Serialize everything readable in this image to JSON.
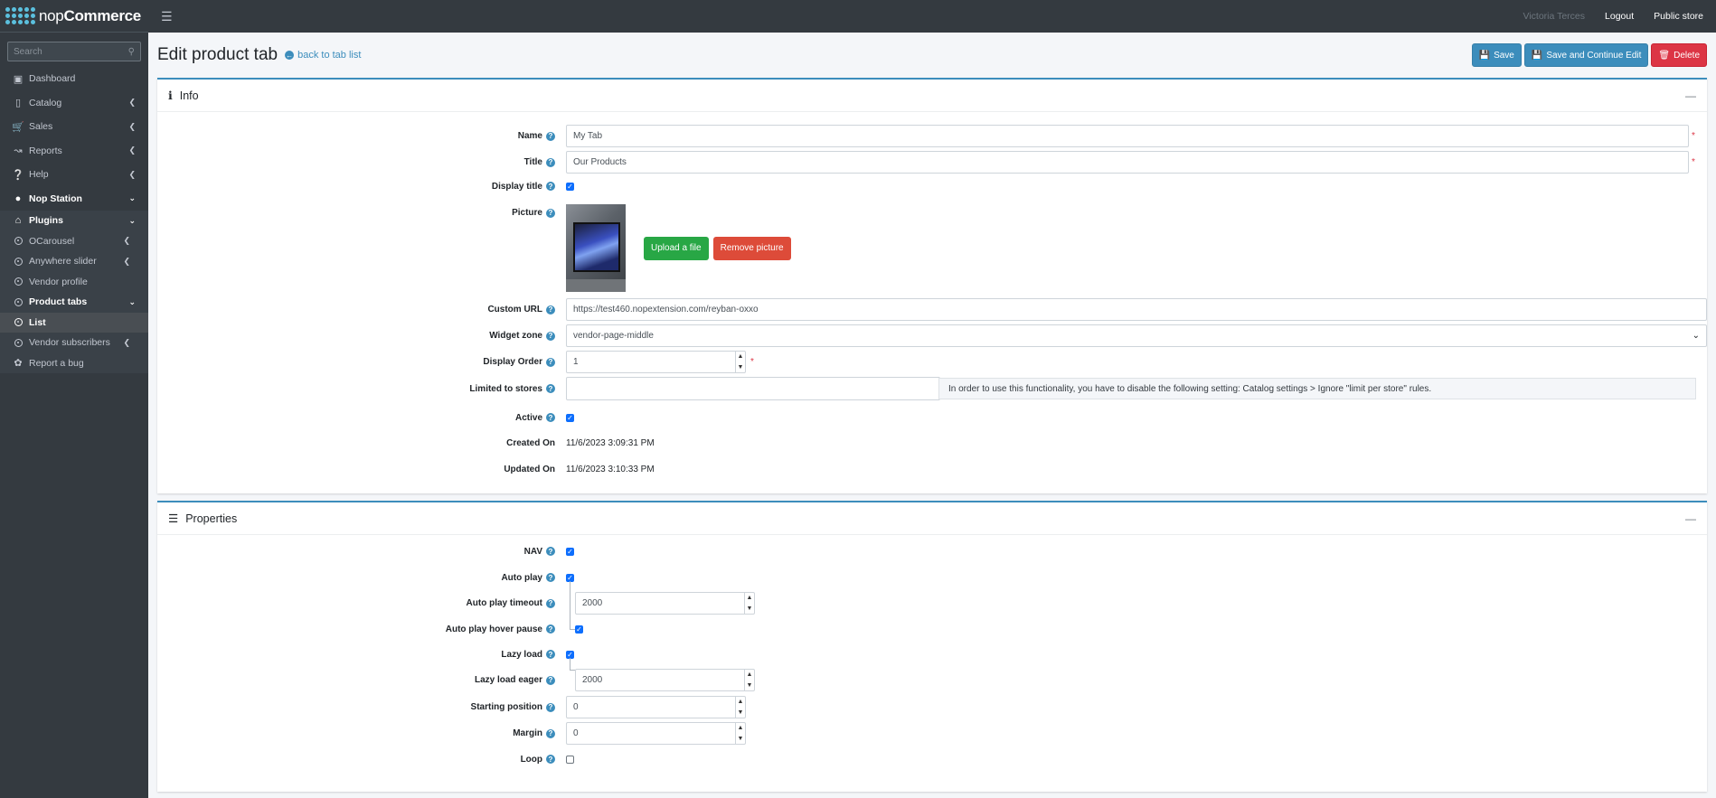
{
  "brand": {
    "light": "nop",
    "bold": "Commerce"
  },
  "search": {
    "placeholder": "Search"
  },
  "sidebar": {
    "items": [
      {
        "label": "Dashboard",
        "icon": "monitor-icon"
      },
      {
        "label": "Catalog",
        "icon": "book-icon"
      },
      {
        "label": "Sales",
        "icon": "cart-icon"
      },
      {
        "label": "Reports",
        "icon": "chart-icon"
      },
      {
        "label": "Help",
        "icon": "question-icon"
      },
      {
        "label": "Nop Station",
        "icon": "circle-icon"
      },
      {
        "label": "Plugins",
        "icon": "home-icon"
      },
      {
        "label": "OCarousel",
        "icon": "circle-dot-icon"
      },
      {
        "label": "Anywhere slider",
        "icon": "circle-dot-icon"
      },
      {
        "label": "Vendor profile",
        "icon": "circle-dot-icon"
      },
      {
        "label": "Product tabs",
        "icon": "circle-dot-icon"
      },
      {
        "label": "List",
        "icon": "circle-dot-icon"
      },
      {
        "label": "Vendor subscribers",
        "icon": "circle-dot-icon"
      },
      {
        "label": "Report a bug",
        "icon": "bug-icon"
      }
    ]
  },
  "topbar": {
    "user": "Victoria Terces",
    "logout": "Logout",
    "public_store": "Public store"
  },
  "page": {
    "title": "Edit product tab",
    "back_link": "back to tab list"
  },
  "actions": {
    "save": "Save",
    "save_continue": "Save and Continue Edit",
    "delete": "Delete"
  },
  "info": {
    "header": "Info",
    "name_label": "Name",
    "name_value": "My Tab",
    "title_label": "Title",
    "title_value": "Our Products",
    "display_title_label": "Display title",
    "display_title_checked": true,
    "picture_label": "Picture",
    "upload_button": "Upload a file",
    "remove_button": "Remove picture",
    "custom_url_label": "Custom URL",
    "custom_url_value": "https://test460.nopextension.com/reyban-oxxo",
    "widget_zone_label": "Widget zone",
    "widget_zone_value": "vendor-page-middle",
    "display_order_label": "Display Order",
    "display_order_value": "1",
    "limited_label": "Limited to stores",
    "limited_note": "In order to use this functionality, you have to disable the following setting: Catalog settings > Ignore \"limit per store\" rules.",
    "active_label": "Active",
    "active_checked": true,
    "created_label": "Created On",
    "created_value": "11/6/2023 3:09:31 PM",
    "updated_label": "Updated On",
    "updated_value": "11/6/2023 3:10:33 PM"
  },
  "properties": {
    "header": "Properties",
    "nav_label": "NAV",
    "nav_checked": true,
    "autoplay_label": "Auto play",
    "autoplay_checked": true,
    "autoplay_timeout_label": "Auto play timeout",
    "autoplay_timeout_value": "2000",
    "autoplay_hover_label": "Auto play hover pause",
    "autoplay_hover_checked": true,
    "lazy_label": "Lazy load",
    "lazy_checked": true,
    "lazy_eager_label": "Lazy load eager",
    "lazy_eager_value": "2000",
    "start_label": "Starting position",
    "start_value": "0",
    "margin_label": "Margin",
    "margin_value": "0",
    "loop_label": "Loop",
    "loop_checked": false
  },
  "colors": {
    "accent": "#3c8dbc",
    "danger": "#dc3545",
    "success": "#28a745",
    "sidebar": "#343a40"
  }
}
